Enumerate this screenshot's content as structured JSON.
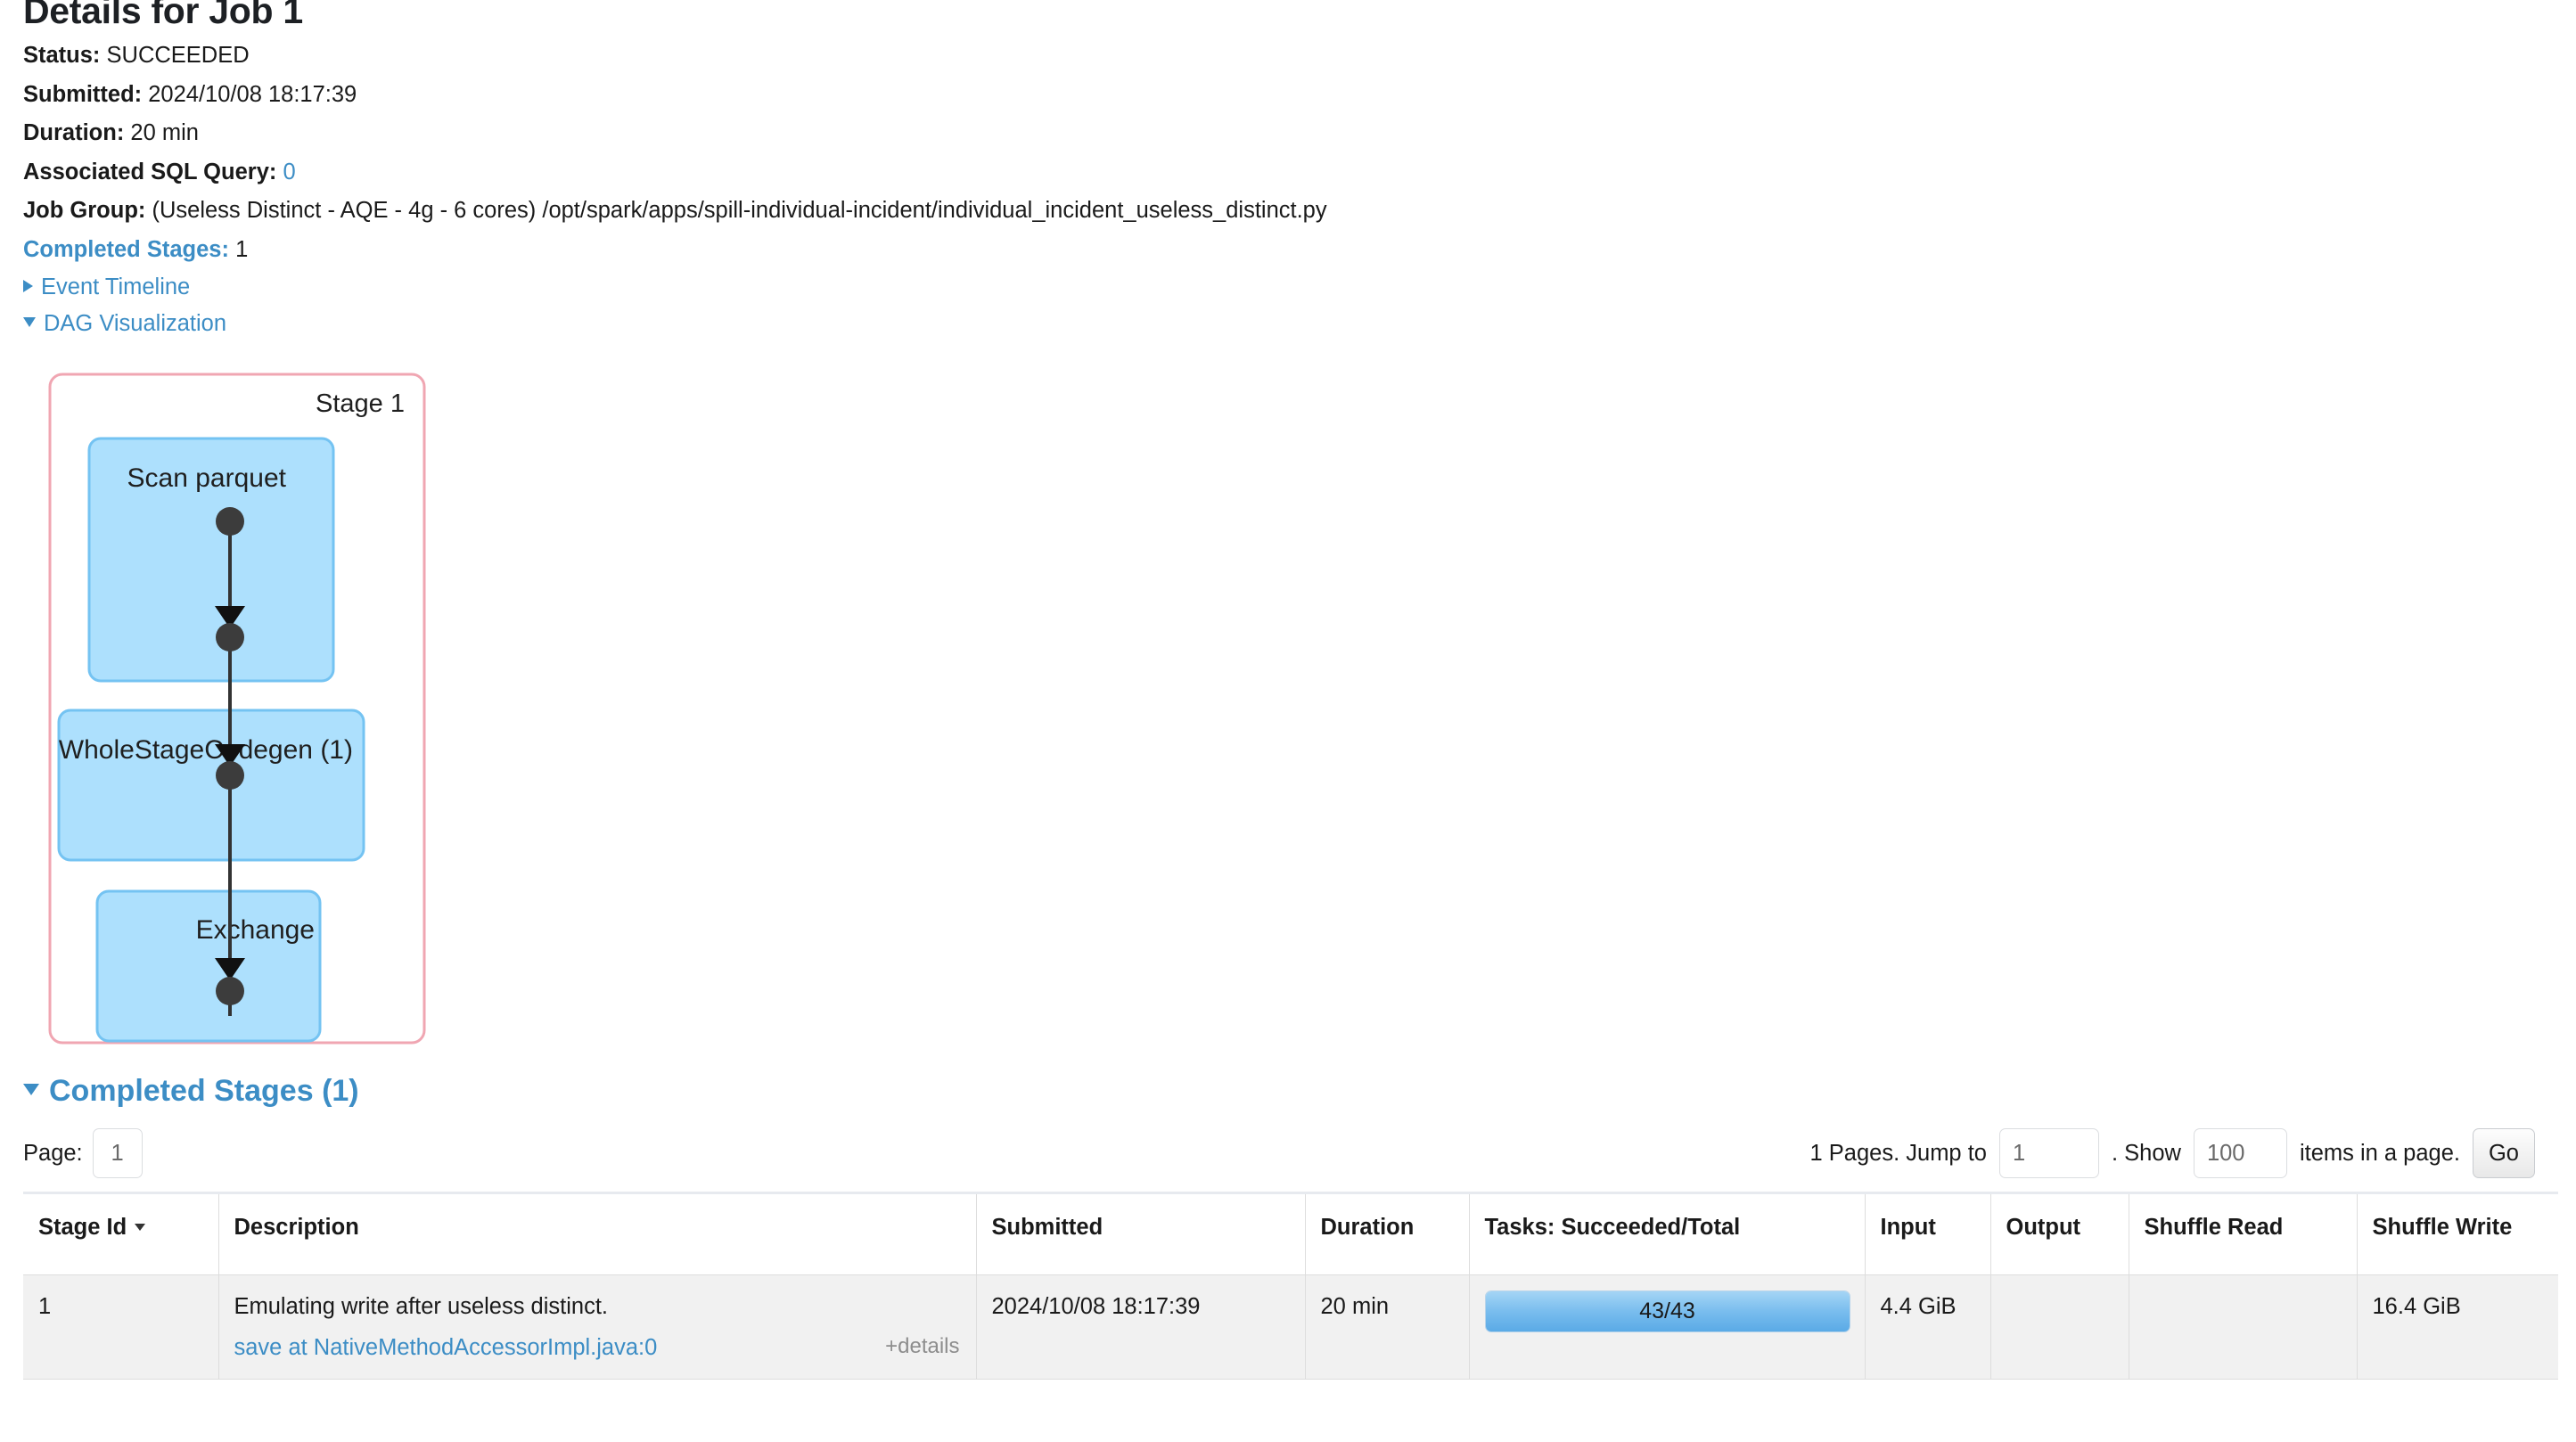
{
  "header": {
    "title": "Details for Job 1"
  },
  "summary": {
    "status_label": "Status:",
    "status_value": "SUCCEEDED",
    "submitted_label": "Submitted:",
    "submitted_value": "2024/10/08 18:17:39",
    "duration_label": "Duration:",
    "duration_value": "20 min",
    "sql_query_label": "Associated SQL Query:",
    "sql_query_value": "0",
    "job_group_label": "Job Group:",
    "job_group_value": "(Useless Distinct - AQE - 4g - 6 cores) /opt/spark/apps/spill-individual-incident/individual_incident_useless_distinct.py",
    "completed_stages_label": "Completed Stages:",
    "completed_stages_value": "1"
  },
  "toggles": {
    "event_timeline": "Event Timeline",
    "dag_visualization": "DAG Visualization"
  },
  "dag": {
    "stage_label": "Stage 1",
    "nodes": [
      {
        "label": "Scan parquet"
      },
      {
        "label": "WholeStageCodegen (1)"
      },
      {
        "label": "Exchange"
      }
    ],
    "stage_border_color": "#f0a6b2",
    "node_fill_color": "#ade0fd",
    "node_border_color": "#74c3f2",
    "edge_color": "#333333"
  },
  "stages_section": {
    "heading": "Completed Stages (1)"
  },
  "pager": {
    "page_label": "Page:",
    "page_value": "1",
    "pages_text": "1 Pages. Jump to",
    "jump_value": "1",
    "dot_show_text": ". Show",
    "show_value": "100",
    "items_text": "items in a page.",
    "go_label": "Go"
  },
  "table": {
    "columns": [
      "Stage Id",
      "Description",
      "Submitted",
      "Duration",
      "Tasks: Succeeded/Total",
      "Input",
      "Output",
      "Shuffle Read",
      "Shuffle Write"
    ],
    "sorted_column": "Stage Id",
    "rows": [
      {
        "stage_id": "1",
        "description_title": "Emulating write after useless distinct.",
        "description_link": "save at NativeMethodAccessorImpl.java:0",
        "details_toggle": "+details",
        "submitted": "2024/10/08 18:17:39",
        "duration": "20 min",
        "tasks_label": "43/43",
        "tasks_succeeded": 43,
        "tasks_total": 43,
        "tasks_percent": 100,
        "input": "4.4 GiB",
        "output": "",
        "shuffle_read": "",
        "shuffle_write": "16.4 GiB"
      }
    ]
  },
  "colors": {
    "link": "#3c8dc5",
    "progress_fill": "#79bdee",
    "row_bg": "#f1f1f1"
  }
}
